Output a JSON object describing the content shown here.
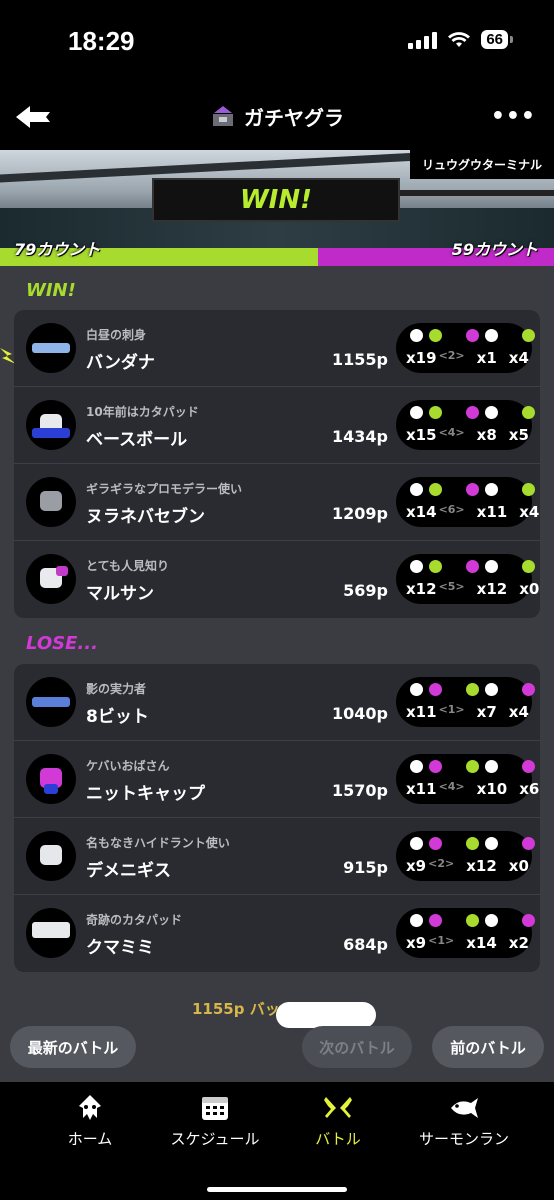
{
  "status_bar": {
    "time": "18:29",
    "battery": "66"
  },
  "header": {
    "title": "ガチヤグラ",
    "more": "•••"
  },
  "banner": {
    "stage": "リュウグウターミナル",
    "result": "WIN!",
    "left_count": "79カウント",
    "right_count": "59カウント"
  },
  "colors": {
    "win": "#a7dc2e",
    "lose": "#c02ac8"
  },
  "win_team": {
    "label": "WIN!",
    "players": [
      {
        "title": "白昼の刺身",
        "name": "バンダナ",
        "points": "1155p",
        "kills": "x19",
        "assists": "<2>",
        "deaths": "x1",
        "specials": "x4"
      },
      {
        "title": "10年前はカタパッド",
        "name": "ベースボール",
        "points": "1434p",
        "kills": "x15",
        "assists": "<4>",
        "deaths": "x8",
        "specials": "x5"
      },
      {
        "title": "ギラギラなプロモデラー使い",
        "name": "ヌラネバセブン",
        "points": "1209p",
        "kills": "x14",
        "assists": "<6>",
        "deaths": "x11",
        "specials": "x4"
      },
      {
        "title": "とても人見知り",
        "name": "マルサン",
        "points": "569p",
        "kills": "x12",
        "assists": "<5>",
        "deaths": "x12",
        "specials": "x0"
      }
    ]
  },
  "lose_team": {
    "label": "LOSE...",
    "players": [
      {
        "title": "影の実力者",
        "name": "8ビット",
        "points": "1040p",
        "kills": "x11",
        "assists": "<1>",
        "deaths": "x7",
        "specials": "x4"
      },
      {
        "title": "ケバいおばさん",
        "name": "ニットキャップ",
        "points": "1570p",
        "kills": "x11",
        "assists": "<4>",
        "deaths": "x10",
        "specials": "x6"
      },
      {
        "title": "名もなきハイドラント使い",
        "name": "デメニギス",
        "points": "915p",
        "kills": "x9",
        "assists": "<2>",
        "deaths": "x12",
        "specials": "x0"
      },
      {
        "title": "奇跡のカタパッド",
        "name": "クマミミ",
        "points": "684p",
        "kills": "x9",
        "assists": "<1>",
        "deaths": "x14",
        "specials": "x2"
      }
    ]
  },
  "peek": "1155p バッジ",
  "actions": {
    "latest": "最新のバトル",
    "next": "次のバトル",
    "prev": "前のバトル"
  },
  "tabs": {
    "home": "ホーム",
    "schedule": "スケジュール",
    "battle": "バトル",
    "salmon": "サーモンラン"
  }
}
